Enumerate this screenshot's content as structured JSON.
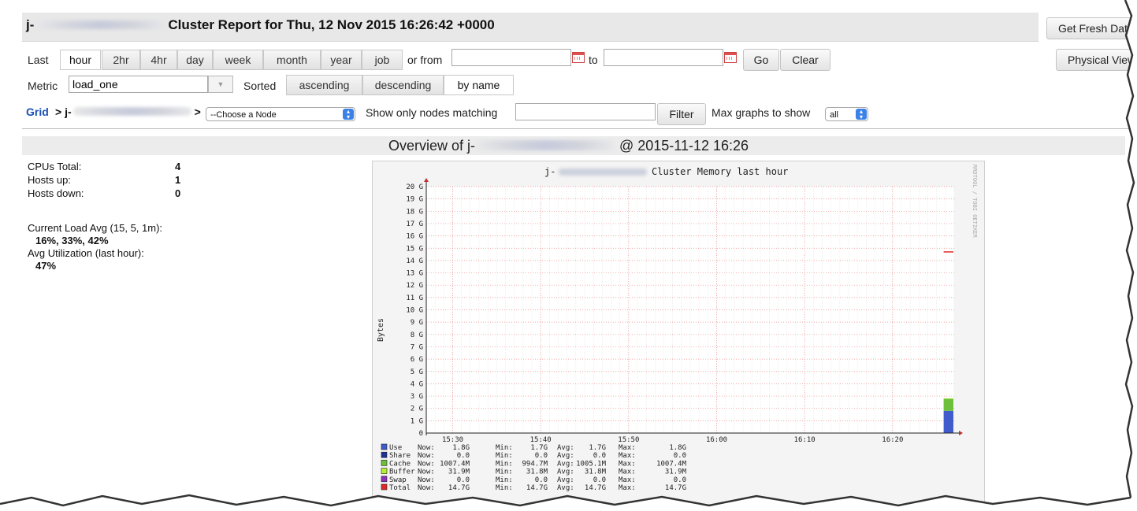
{
  "header": {
    "title_prefix": "j-",
    "title_suffix": "Cluster Report for Thu, 12 Nov 2015 16:26:42 +0000",
    "fresh_button": "Get Fresh Data",
    "physical_button": "Physical View"
  },
  "range": {
    "last_label": "Last",
    "options": [
      "hour",
      "2hr",
      "4hr",
      "day",
      "week",
      "month",
      "year",
      "job"
    ],
    "active": "hour",
    "or_from_label": "or from",
    "from_value": "",
    "to_label": "to",
    "to_value": "",
    "go_button": "Go",
    "clear_button": "Clear"
  },
  "metric": {
    "label": "Metric",
    "value": "load_one",
    "sorted_label": "Sorted",
    "sort_options": [
      "ascending",
      "descending",
      "by name"
    ],
    "active_sort": "by name"
  },
  "nav": {
    "grid_link": "Grid",
    "separator": ">",
    "cluster_prefix": "j-",
    "node_select": "--Choose a Node",
    "match_label": "Show only nodes matching",
    "match_value": "",
    "filter_button": "Filter",
    "max_label": "Max graphs to show",
    "max_value": "all"
  },
  "overview": {
    "prefix": "Overview of j-",
    "suffix": "@ 2015-11-12 16:26"
  },
  "stats": {
    "cpus_label": "CPUs Total:",
    "cpus_value": "4",
    "hosts_up_label": "Hosts up:",
    "hosts_up_value": "1",
    "hosts_down_label": "Hosts down:",
    "hosts_down_value": "0",
    "load_label": "Current Load Avg (15, 5, 1m):",
    "load_value": "16%, 33%, 42%",
    "util_label": "Avg Utilization (last hour):",
    "util_value": "47%"
  },
  "chart_data": {
    "type": "area",
    "title_prefix": "j-",
    "title_suffix": "Cluster Memory last hour",
    "ylabel": "Bytes",
    "watermark": "RRDTOOL / TOBI OETIKER",
    "ylim": [
      0,
      20
    ],
    "y_ticks": [
      "0",
      "1 G",
      "2 G",
      "3 G",
      "4 G",
      "5 G",
      "6 G",
      "7 G",
      "8 G",
      "9 G",
      "10 G",
      "11 G",
      "12 G",
      "13 G",
      "14 G",
      "15 G",
      "16 G",
      "17 G",
      "18 G",
      "19 G",
      "20 G"
    ],
    "x_ticks": [
      "15:30",
      "15:40",
      "15:50",
      "16:00",
      "16:10",
      "16:20"
    ],
    "x_tick_minutes": [
      30,
      40,
      50,
      60,
      70,
      80
    ],
    "x_range_minutes": [
      27,
      87
    ],
    "data_start_minute": 85.8,
    "grid": true,
    "colors": {
      "use": "#3f5bcc",
      "share": "#1d3196",
      "cache": "#6dbf3c",
      "buffer": "#b6ef30",
      "swap": "#8e2fbf",
      "total": "#e02828"
    },
    "series": [
      {
        "name": "Use",
        "value": 1.8,
        "now": "1.8G",
        "min": "1.7G",
        "avg": "1.7G",
        "max": "1.8G",
        "color": "#3f5bcc"
      },
      {
        "name": "Share",
        "value": 0,
        "now": "0.0",
        "min": "0.0",
        "avg": "0.0",
        "max": "0.0",
        "color": "#1d3196"
      },
      {
        "name": "Cache",
        "value": 0.984,
        "now": "1007.4M",
        "min": "994.7M",
        "avg": "1005.1M",
        "max": "1007.4M",
        "color": "#6dbf3c"
      },
      {
        "name": "Buffer",
        "value": 0.031,
        "now": "31.9M",
        "min": "31.8M",
        "avg": "31.8M",
        "max": "31.9M",
        "color": "#b6ef30"
      },
      {
        "name": "Swap",
        "value": 0,
        "now": "0.0",
        "min": "0.0",
        "avg": "0.0",
        "max": "0.0",
        "color": "#8e2fbf"
      },
      {
        "name": "Total",
        "value": 14.7,
        "now": "14.7G",
        "min": "14.7G",
        "avg": "14.7G",
        "max": "14.7G",
        "color": "#e02828"
      }
    ],
    "legend_labels": {
      "now": "Now:",
      "min": "Min:",
      "avg": "Avg:",
      "max": "Max:"
    }
  }
}
